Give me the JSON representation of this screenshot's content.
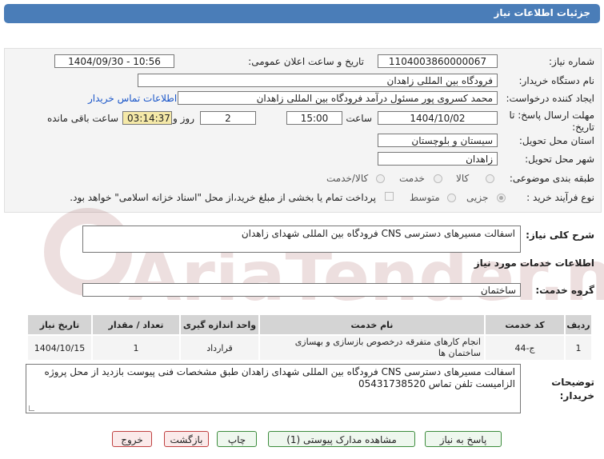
{
  "header": {
    "title": "جزئیات اطلاعات نیاز"
  },
  "form": {
    "need_number_label": "شماره نیاز:",
    "need_number": "1104003860000067",
    "announce_label": "تاریخ و ساعت اعلان عمومی:",
    "announce_value": "1404/09/30 - 10:56",
    "buyer_label": "نام دستگاه خریدار:",
    "buyer_value": "فرودگاه بین المللی زاهدان",
    "creator_label": "ایجاد کننده درخواست:",
    "creator_value": "محمد کسروی پور مسئول درآمد فرودگاه بین المللی زاهدان",
    "contact_link": "اطلاعات تماس خریدار",
    "deadline_label": "مهلت ارسال پاسخ: تا تاریخ:",
    "deadline_date": "1404/10/02",
    "time_label": "ساعت",
    "deadline_time": "15:00",
    "days_value": "2",
    "days_label": "روز و",
    "remaining_time": "03:14:37",
    "remaining_label": "ساعت باقی مانده",
    "province_label": "استان محل تحویل:",
    "province_value": "سیستان و بلوچستان",
    "city_label": "شهر محل تحویل:",
    "city_value": "زاهدان",
    "category_label": "طبقه بندی موضوعی:",
    "category_options": [
      "کالا",
      "خدمت",
      "کالا/خدمت"
    ],
    "process_label": "نوع فرآیند خرید :",
    "process_options": [
      "جزیی",
      "متوسط"
    ],
    "payment_text": "پرداخت تمام یا بخشی از مبلغ خرید،از محل \"اسناد خزانه اسلامی\" خواهد بود."
  },
  "summary": {
    "label": "شرح کلی نیاز:",
    "value": "اسفالت مسیرهای دسترسی CNS فرودگاه بین المللی شهدای زاهدان"
  },
  "services": {
    "heading": "اطلاعات خدمات مورد نیاز",
    "group_label": "گروه خدمت:",
    "group_value": "ساختمان",
    "columns": [
      "ردیف",
      "کد خدمت",
      "نام خدمت",
      "واحد اندازه گیری",
      "تعداد / مقدار",
      "تاریخ نیاز"
    ],
    "rows": [
      {
        "idx": "1",
        "code": "ج-44",
        "name": "انجام کارهای متفرقه درخصوص بازسازی و بهسازی ساختمان ها",
        "unit": "قرارداد",
        "qty": "1",
        "date": "1404/10/15"
      }
    ]
  },
  "notes": {
    "label": "توضیحات خریدار:",
    "line1": "اسفالت مسیرهای دسترسی CNS فرودگاه بین المللی شهدای زاهدان طبق مشخصات فنی پیوست بازدید از محل پروژه",
    "line2": "الزامیست تلفن تماس 05431738520"
  },
  "buttons": {
    "reply": "پاسخ به نیاز",
    "docs": "مشاهده مدارک پیوستی (1)",
    "print": "چاپ",
    "back": "بازگشت",
    "exit": "خروج"
  },
  "watermark": {
    "text": "AriaTender.net"
  },
  "colors": {
    "header": "#4a7db8",
    "link": "#1a56c9",
    "remaining_bg": "#f5e9a8"
  }
}
